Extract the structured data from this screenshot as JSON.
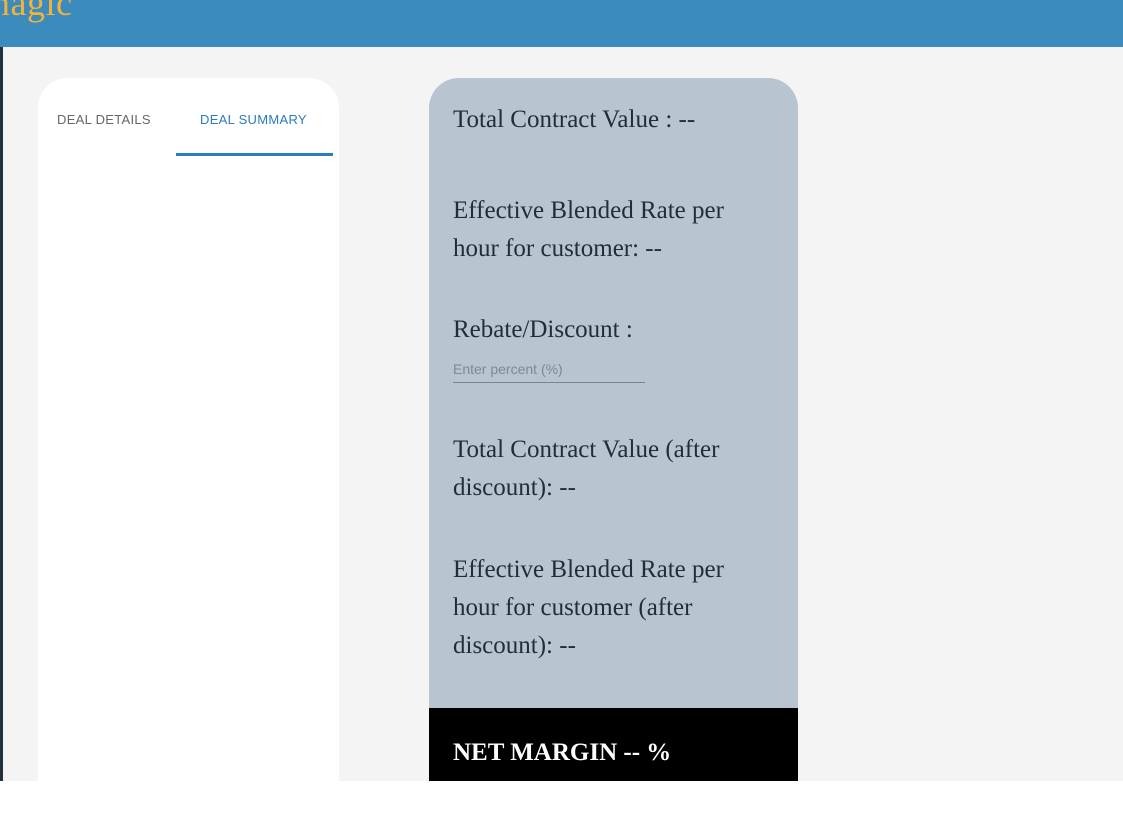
{
  "header": {
    "logo_text": "magic",
    "background_color": "#3b8bbd",
    "logo_color": "#f4b23a"
  },
  "tabs": [
    {
      "label": "DEAL DETAILS",
      "active": false
    },
    {
      "label": "DEAL SUMMARY",
      "active": true
    }
  ],
  "summary": {
    "total_contract_value": "Total Contract Value : --",
    "effective_blended_rate": "Effective Blended Rate per hour for customer: --",
    "rebate_label": "Rebate/Discount :",
    "rebate_input_value": "",
    "rebate_input_placeholder": "Enter percent (%)",
    "total_contract_value_after": "Total Contract Value (after discount): --",
    "effective_blended_rate_after": "Effective Blended Rate per hour for customer (after discount): --",
    "net_margin": "NET MARGIN -- %"
  },
  "colors": {
    "accent": "#2a7bc0",
    "summary_card": "#b8c4d0",
    "net_bar": "#000000"
  }
}
